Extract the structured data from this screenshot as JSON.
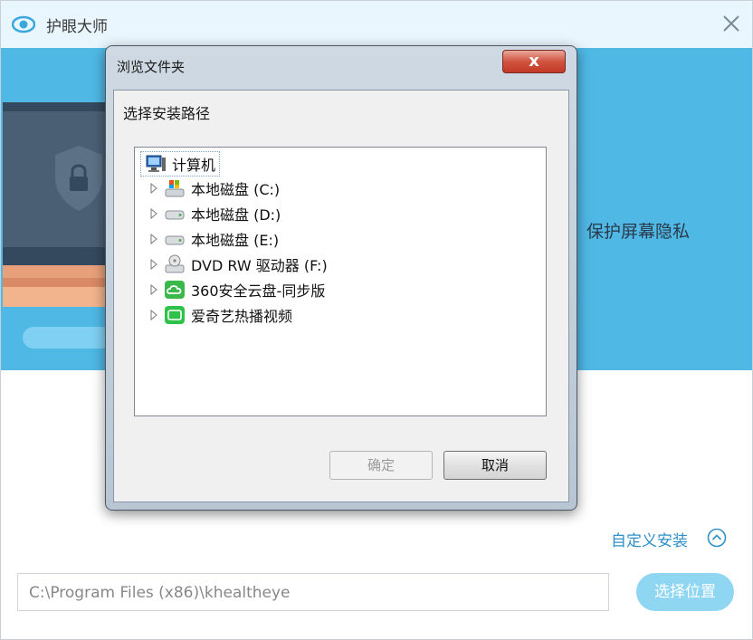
{
  "app": {
    "title": "护眼大师",
    "feature_text": "、保护屏幕隐私",
    "custom_install_label": "自定义安装",
    "path_value": "C:\\Program Files (x86)\\khealtheye",
    "choose_location_label": "选择位置",
    "colors": {
      "header_bg": "#4fb8e5",
      "accent": "#2e8fc9",
      "button_bg": "#8fd6f2"
    }
  },
  "dialog": {
    "title": "浏览文件夹",
    "close_label": "x",
    "prompt": "选择安装路径",
    "tree": {
      "root": {
        "label": "计算机",
        "icon": "computer-icon"
      },
      "children": [
        {
          "label": "本地磁盘 (C:)",
          "icon": "windows-drive-icon"
        },
        {
          "label": "本地磁盘 (D:)",
          "icon": "hard-drive-icon"
        },
        {
          "label": "本地磁盘 (E:)",
          "icon": "hard-drive-icon"
        },
        {
          "label": "DVD RW 驱动器 (F:)",
          "icon": "dvd-drive-icon"
        },
        {
          "label": "360安全云盘-同步版",
          "icon": "cloud-drive-icon"
        },
        {
          "label": "爱奇艺热播视频",
          "icon": "iqiyi-icon"
        }
      ]
    },
    "ok_label": "确定",
    "cancel_label": "取消"
  }
}
